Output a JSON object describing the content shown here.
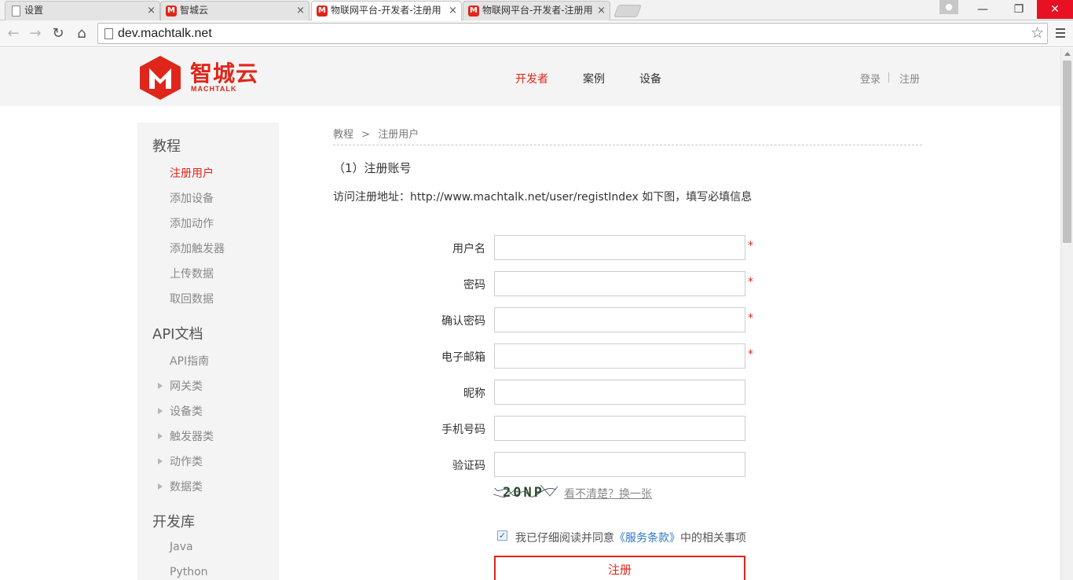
{
  "browser": {
    "tabs": [
      {
        "title": "设置",
        "favicon": "page-icon"
      },
      {
        "title": "智城云",
        "favicon": "machtalk-icon"
      },
      {
        "title": "物联网平台-开发者-注册用",
        "favicon": "machtalk-icon",
        "active": true
      },
      {
        "title": "物联网平台-开发者-注册用",
        "favicon": "machtalk-icon"
      }
    ],
    "tab_close": "×",
    "window_controls": {
      "minimize": "—",
      "restore": "❐",
      "close": "✕"
    },
    "url": "dev.machtalk.net"
  },
  "header": {
    "logo_cn": "智城云",
    "logo_en": "MACHTALK",
    "nav": [
      "开发者",
      "案例",
      "设备"
    ],
    "active_nav": "开发者",
    "login": "登录",
    "register": "注册",
    "brand_color": "#e0261a"
  },
  "sidebar": {
    "tutorial": {
      "heading": "教程",
      "items": [
        "注册用户",
        "添加设备",
        "添加动作",
        "添加触发器",
        "上传数据",
        "取回数据"
      ]
    },
    "api": {
      "heading": "API文档",
      "items": [
        "API指南",
        "网关类",
        "设备类",
        "触发器类",
        "动作类",
        "数据类"
      ]
    },
    "libs": {
      "heading": "开发库",
      "items": [
        "Java",
        "Python"
      ]
    }
  },
  "main": {
    "breadcrumb": [
      "教程",
      ">",
      "注册用户"
    ],
    "section_title": "（1）注册账号",
    "description": "访问注册地址：http://www.machtalk.net/user/registIndex 如下图，填写必填信息",
    "form": {
      "fields": [
        {
          "label": "用户名",
          "value": "",
          "required": true
        },
        {
          "label": "密码",
          "value": "",
          "required": true
        },
        {
          "label": "确认密码",
          "value": "",
          "required": true
        },
        {
          "label": "电子邮箱",
          "value": "",
          "required": true
        },
        {
          "label": "昵称",
          "value": "",
          "required": false
        },
        {
          "label": "手机号码",
          "value": "",
          "required": false
        },
        {
          "label": "验证码",
          "value": "",
          "required": false
        }
      ],
      "required_mark": "*",
      "captcha_text": "20NP",
      "captcha_refresh": "看不清楚？换一张",
      "agree_checked": true,
      "agree_prefix": "我已仔细阅读并同意",
      "agree_terms": "《服务条款》",
      "agree_suffix": "中的相关事项",
      "submit": "注册"
    }
  }
}
